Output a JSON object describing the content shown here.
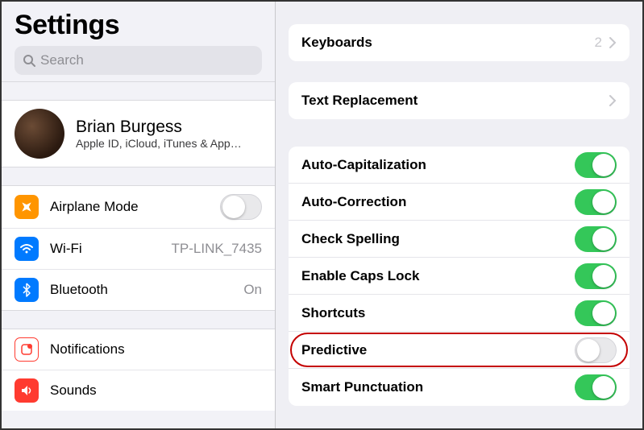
{
  "sidebar": {
    "title": "Settings",
    "search_placeholder": "Search",
    "profile": {
      "name": "Brian Burgess",
      "subtitle": "Apple ID, iCloud, iTunes & App…"
    },
    "items": [
      {
        "label": "Airplane Mode",
        "toggle": false
      },
      {
        "label": "Wi-Fi",
        "value": "TP-LINK_7435"
      },
      {
        "label": "Bluetooth",
        "value": "On"
      }
    ],
    "items2": [
      {
        "label": "Notifications"
      },
      {
        "label": "Sounds"
      }
    ]
  },
  "detail": {
    "group1": [
      {
        "label": "Keyboards",
        "value": "2"
      }
    ],
    "group2": [
      {
        "label": "Text Replacement"
      }
    ],
    "group3": [
      {
        "label": "Auto-Capitalization",
        "toggle": true
      },
      {
        "label": "Auto-Correction",
        "toggle": true
      },
      {
        "label": "Check Spelling",
        "toggle": true
      },
      {
        "label": "Enable Caps Lock",
        "toggle": true
      },
      {
        "label": "Shortcuts",
        "toggle": true
      },
      {
        "label": "Predictive",
        "toggle": false,
        "highlighted": true
      },
      {
        "label": "Smart Punctuation",
        "toggle": true
      }
    ]
  }
}
